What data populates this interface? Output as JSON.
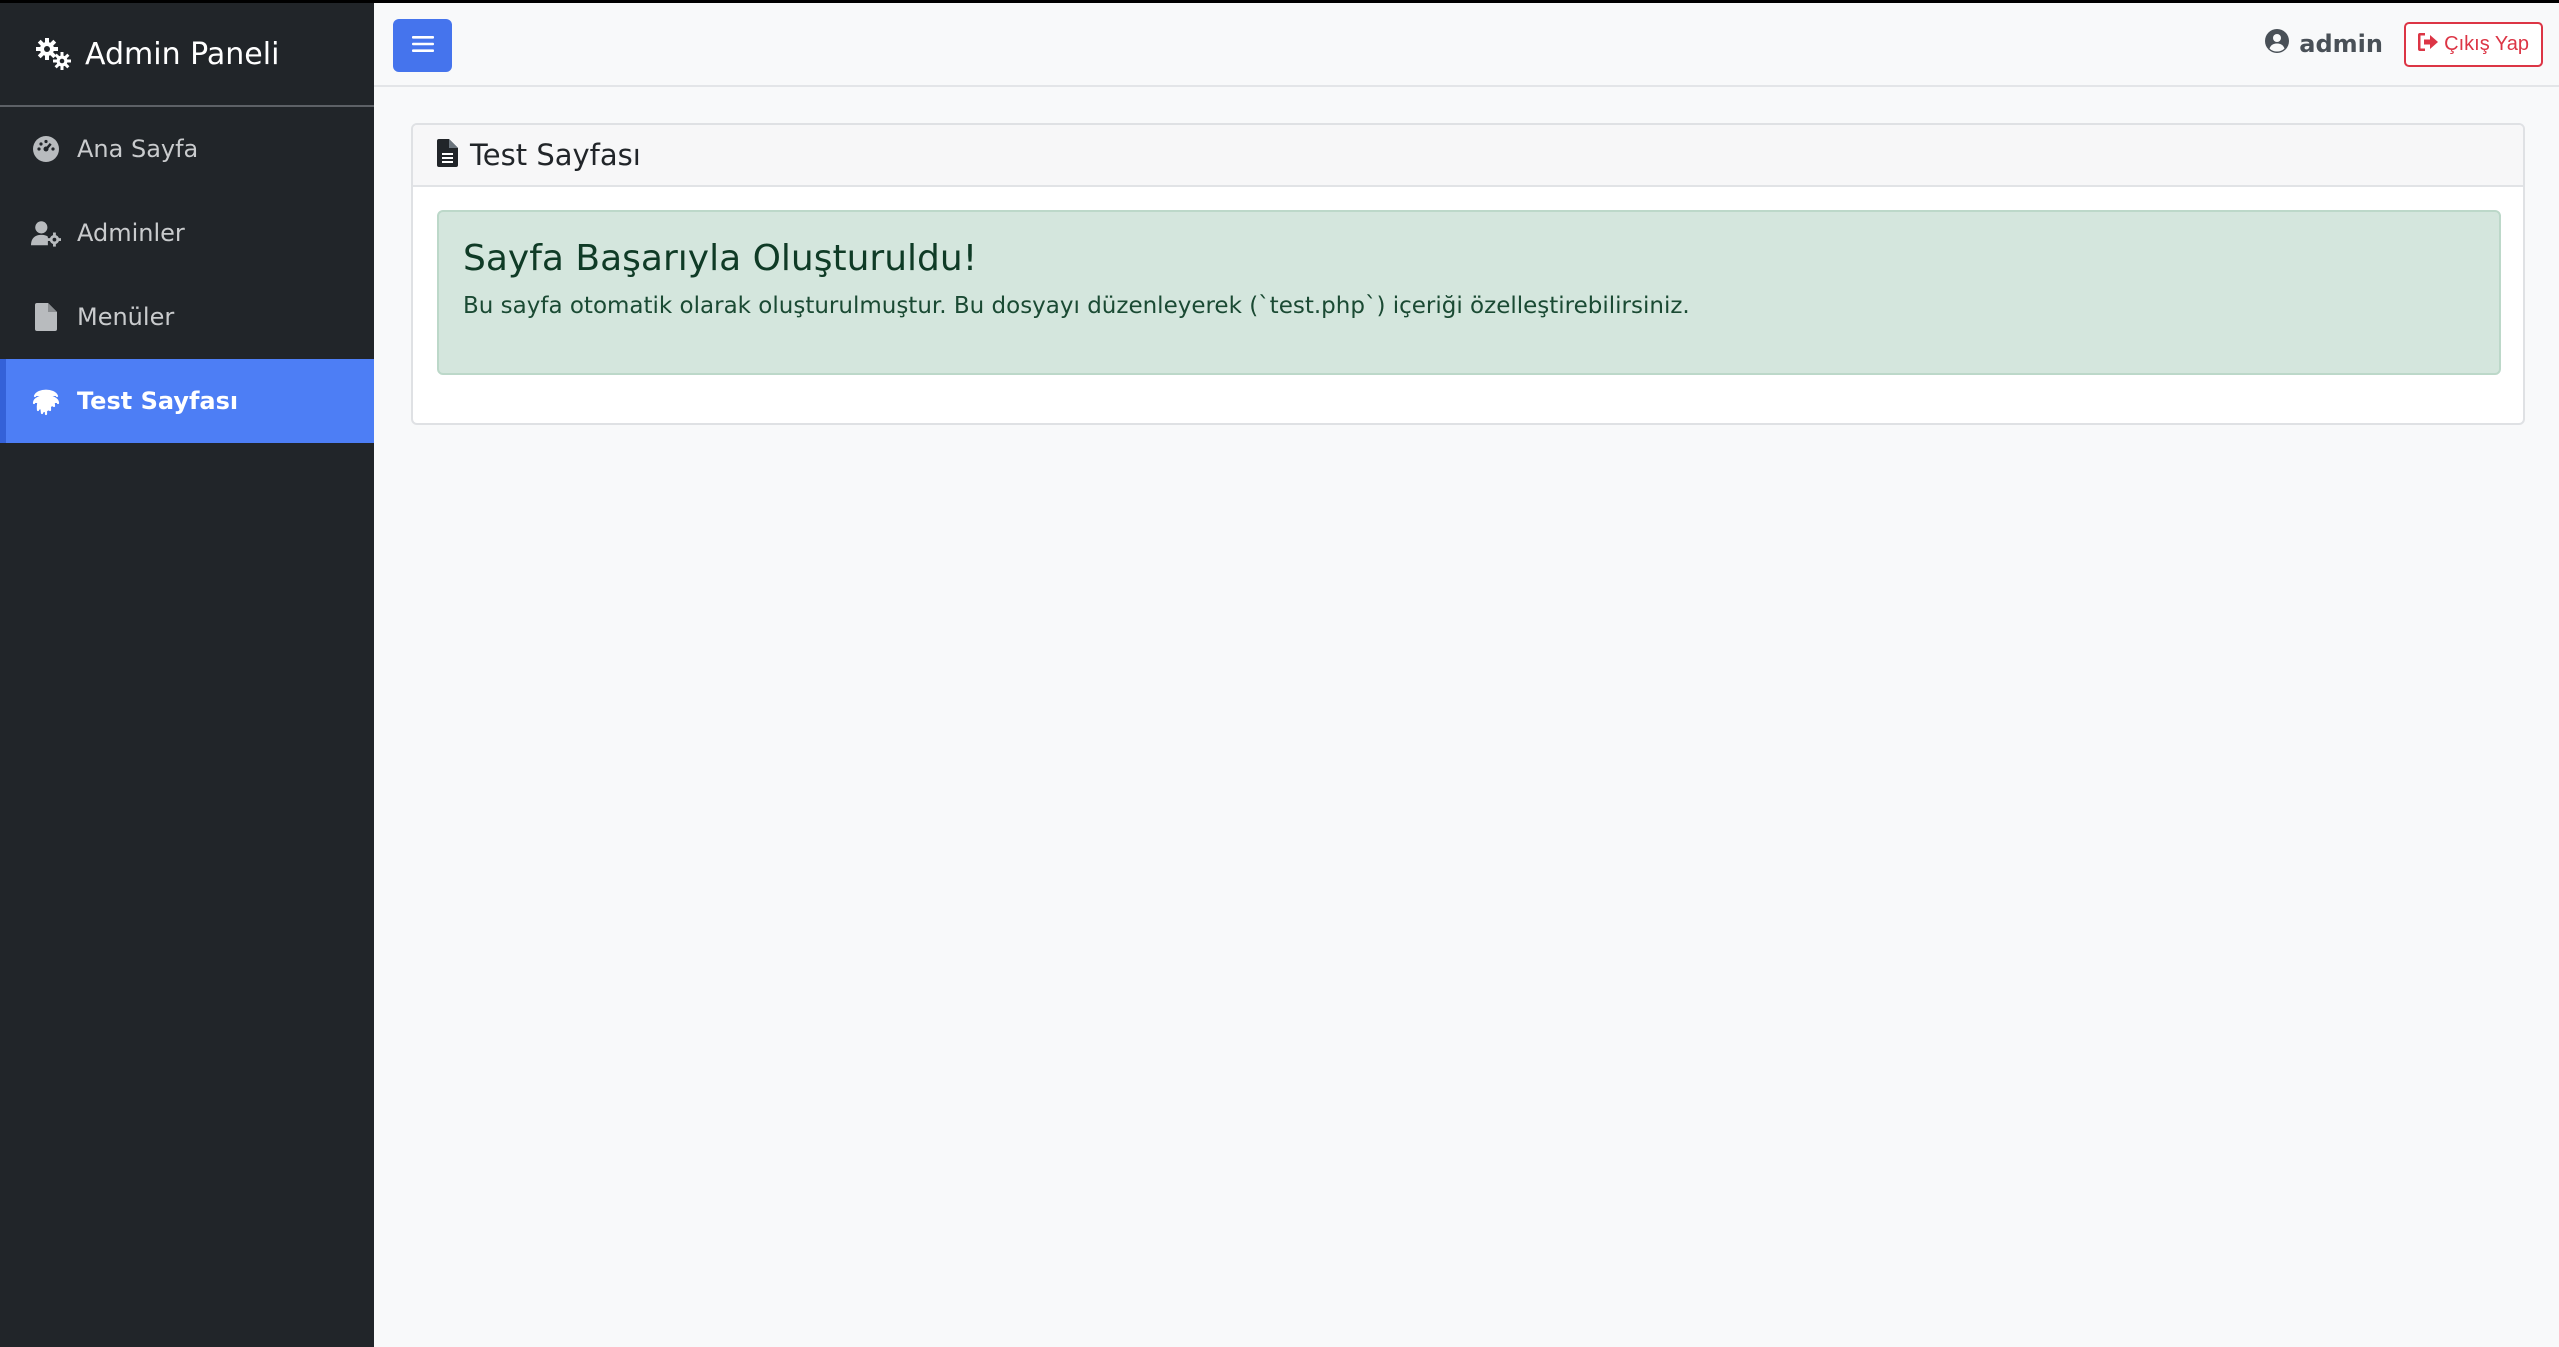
{
  "sidebar": {
    "brand": "Admin Paneli",
    "items": [
      {
        "label": "Ana Sayfa",
        "icon": "dashboard-icon"
      },
      {
        "label": "Adminler",
        "icon": "user-cog-icon"
      },
      {
        "label": "Menüler",
        "icon": "file-icon"
      },
      {
        "label": "Test Sayfası",
        "icon": "fingerprint-icon",
        "active": true
      }
    ]
  },
  "topbar": {
    "toggle_icon": "hamburger-icon",
    "username": "admin",
    "logout_label": "Çıkış Yap"
  },
  "card": {
    "title": "Test Sayfası",
    "alert_heading": "Sayfa Başarıyla Oluşturuldu!",
    "alert_text": "Bu sayfa otomatik olarak oluşturulmuştur. Bu dosyayı düzenleyerek (`test.php`) içeriği özelleştirebilirsiniz."
  },
  "colors": {
    "sidebar_bg": "#212529",
    "active_item": "#4d7ef5",
    "primary_button": "#4574ed",
    "danger": "#dc3545",
    "success_alert_bg": "#d4e6dd"
  }
}
